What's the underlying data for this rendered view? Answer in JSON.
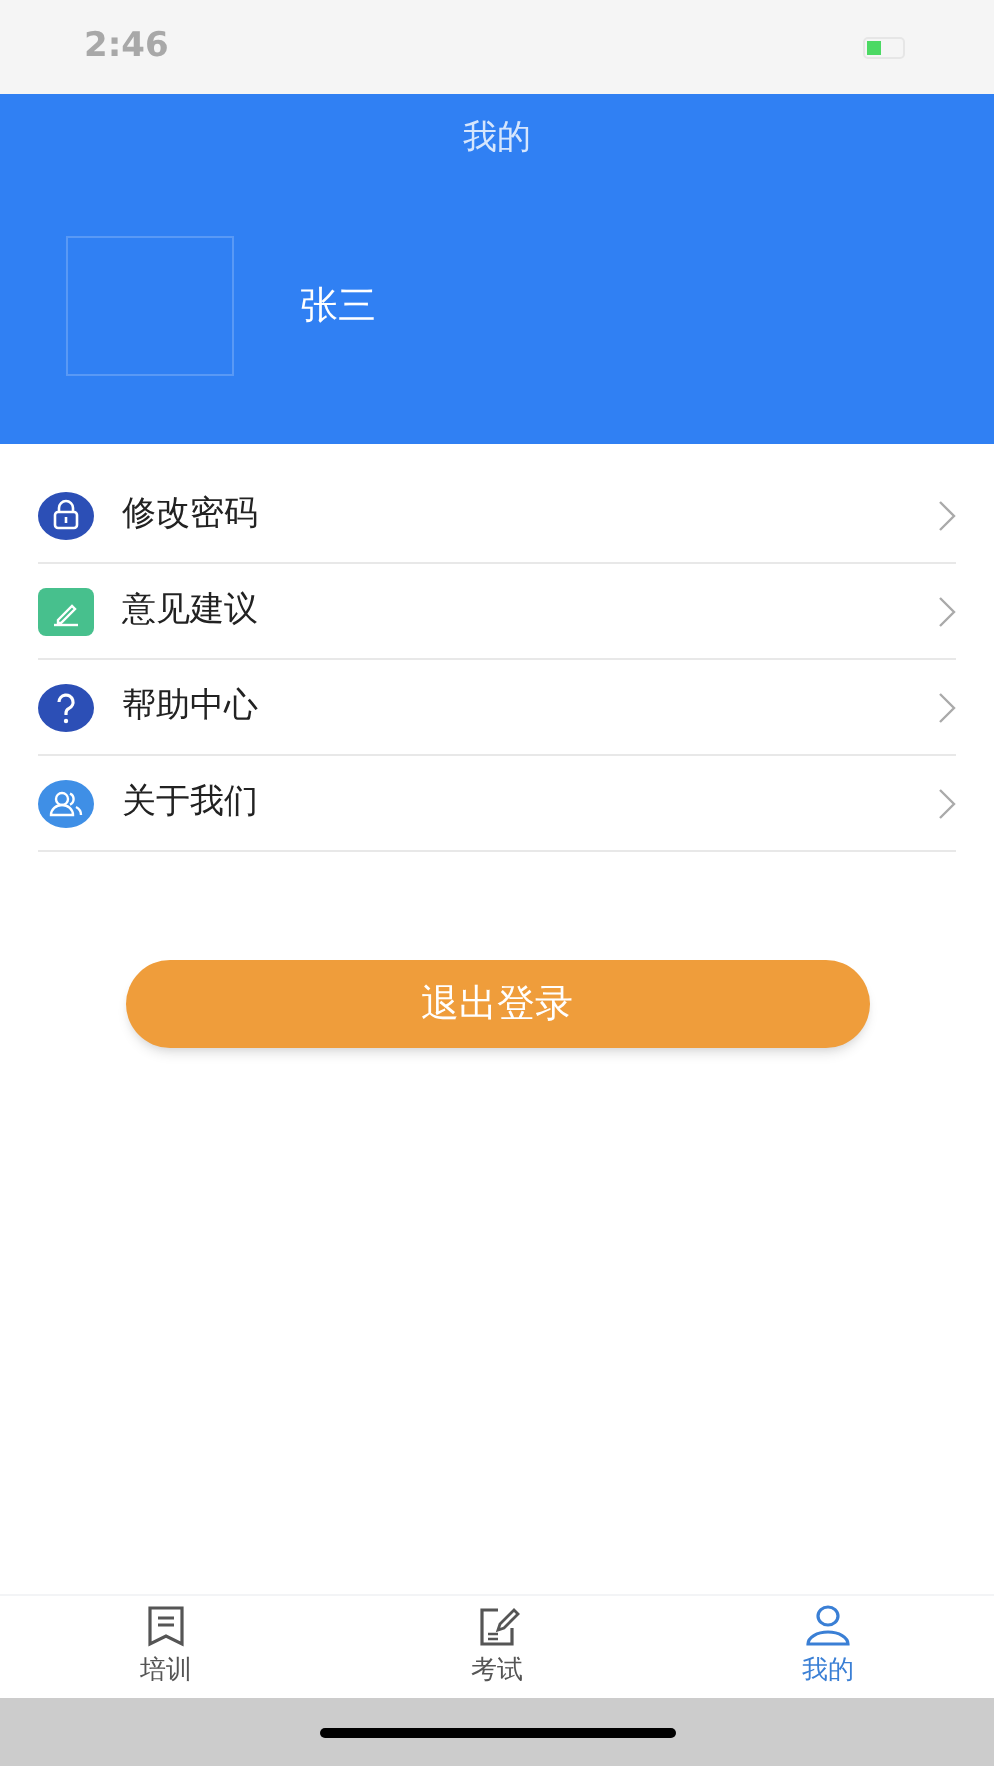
{
  "status_bar": {
    "time": "2:46"
  },
  "header": {
    "title": "我的",
    "user_name": "张三"
  },
  "menu": [
    {
      "kind": "lock",
      "label": "修改密码"
    },
    {
      "kind": "pen",
      "label": "意见建议"
    },
    {
      "kind": "help",
      "label": "帮助中心"
    },
    {
      "kind": "people",
      "label": "关于我们"
    }
  ],
  "logout_button": "退出登录",
  "tab_bar": [
    {
      "kind": "book",
      "label": "培训",
      "selected": false
    },
    {
      "kind": "exam",
      "label": "考试",
      "selected": false
    },
    {
      "kind": "person",
      "label": "我的",
      "selected": true
    }
  ]
}
